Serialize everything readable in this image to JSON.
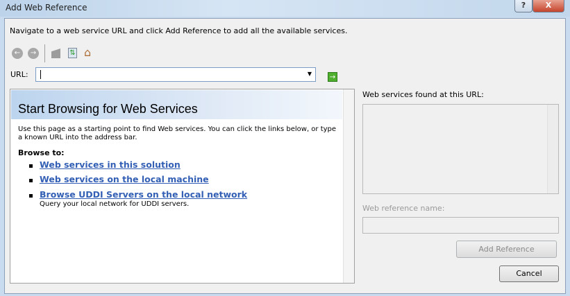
{
  "window": {
    "title": "Add Web Reference",
    "help_label": "?",
    "close_label": "X"
  },
  "instructions": "Navigate to a web service URL and click Add Reference to add all the available services.",
  "toolbar": {
    "back": "←",
    "forward": "→",
    "go": "→"
  },
  "url": {
    "label": "URL:",
    "value": ""
  },
  "browser": {
    "title": "Start Browsing for Web Services",
    "description": "Use this page as a starting point to find Web services. You can click the links below, or type a known URL into the address bar.",
    "browse_to": "Browse to:",
    "links": [
      "Web services in this solution",
      "Web services on the local machine",
      "Browse UDDI Servers on the local network"
    ],
    "uddi_desc": "Query your local network for UDDI servers."
  },
  "right": {
    "found_label": "Web services found at this URL:",
    "name_label": "Web reference name:",
    "name_value": "",
    "add_reference": "Add Reference"
  },
  "cancel": "Cancel"
}
